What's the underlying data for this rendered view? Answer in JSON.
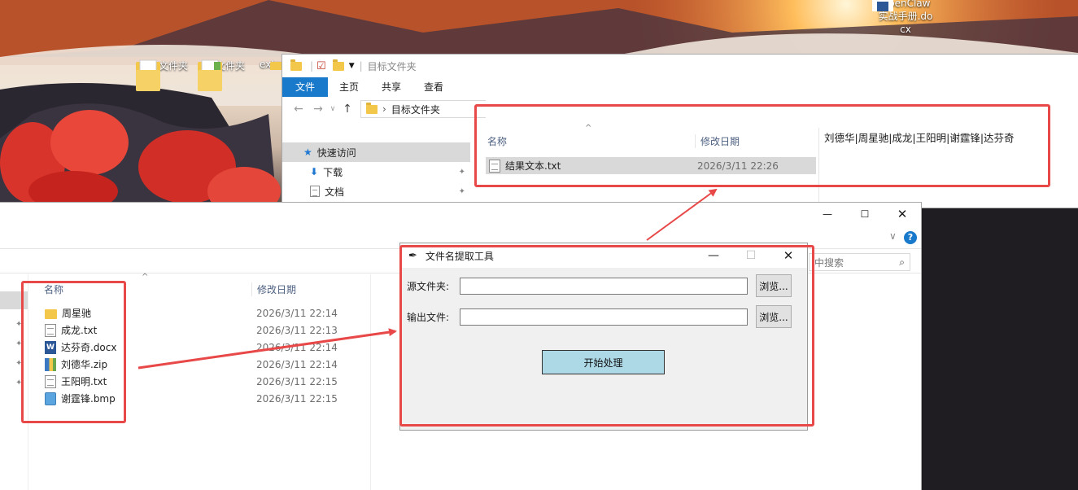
{
  "desktop": {
    "icons": [
      {
        "label": "目标文件夹"
      },
      {
        "label": "原文件夹"
      },
      {
        "label": "extra"
      },
      {
        "label": "OpenClaw实战手册.docx"
      }
    ]
  },
  "top_explorer": {
    "title": "目标文件夹",
    "ribbon_tabs": [
      "文件",
      "主页",
      "共享",
      "查看"
    ],
    "address": "目标文件夹",
    "nav_items": [
      {
        "label": "快速访问",
        "icon": "star-pin-icon"
      },
      {
        "label": "下载",
        "icon": "download-arrow-icon"
      },
      {
        "label": "文档",
        "icon": "document-icon"
      }
    ],
    "columns": {
      "name": "名称",
      "date": "修改日期"
    },
    "files": [
      {
        "name": "结果文本.txt",
        "date": "2026/3/11 22:26",
        "icon": "txt"
      }
    ],
    "preview_text": "刘德华|周星驰|成龙|王阳明|谢霆锋|达芬奇"
  },
  "bottom_explorer": {
    "columns": {
      "name": "名称",
      "date": "修改日期"
    },
    "search_placeholder": "中搜索",
    "files": [
      {
        "name": "周星驰",
        "date": "2026/3/11 22:14",
        "icon": "folder"
      },
      {
        "name": "成龙.txt",
        "date": "2026/3/11 22:13",
        "icon": "txt"
      },
      {
        "name": "达芬奇.docx",
        "date": "2026/3/11 22:14",
        "icon": "docx"
      },
      {
        "name": "刘德华.zip",
        "date": "2026/3/11 22:14",
        "icon": "zip"
      },
      {
        "name": "王阳明.txt",
        "date": "2026/3/11 22:15",
        "icon": "txt"
      },
      {
        "name": "谢霆锋.bmp",
        "date": "2026/3/11 22:15",
        "icon": "bmp"
      }
    ]
  },
  "tool": {
    "title": "文件名提取工具",
    "source_label": "源文件夹:",
    "source_value": "",
    "output_label": "输出文件:",
    "output_value": "",
    "browse_label": "浏览...",
    "start_label": "开始处理"
  },
  "colors": {
    "accent": "#1979ca",
    "highlight": "#e84848",
    "start_button": "#add8e6"
  }
}
